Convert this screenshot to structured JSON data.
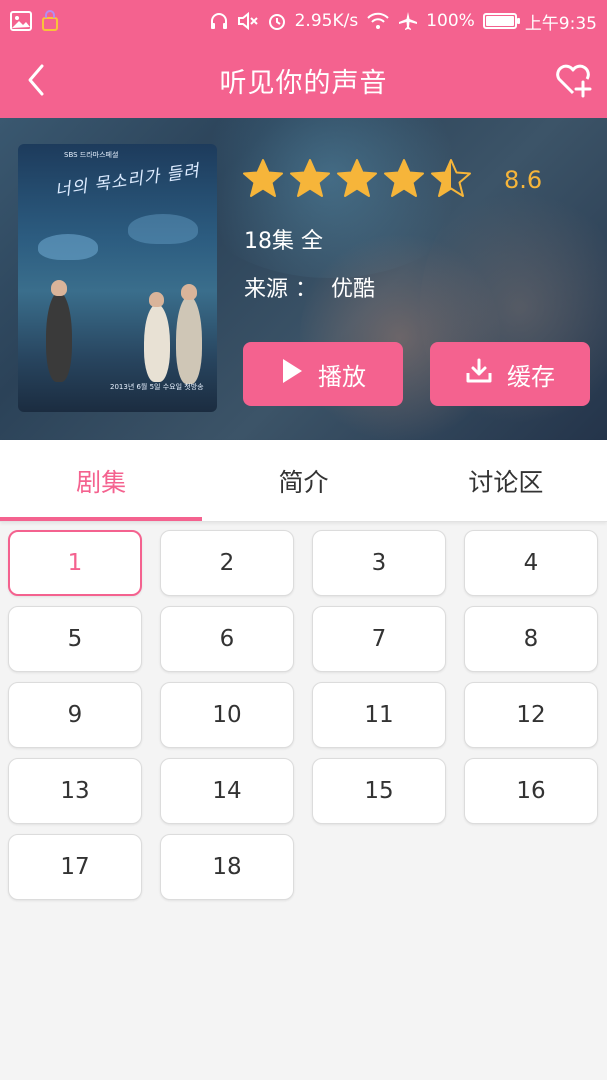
{
  "status_bar": {
    "speed": "2.95K/s",
    "battery_percent": "100%",
    "time": "上午9:35",
    "battery_level": 1.0
  },
  "nav": {
    "title": "听见你的声音"
  },
  "hero": {
    "rating_stars": 4.5,
    "max_stars": 5,
    "score": "8.6",
    "episodes_total": "18集 全",
    "source": "来源 ：  优酷",
    "poster": {
      "logo": "SBS 드라마스페셜",
      "title": "너의 목소리가 들려",
      "date": "2013년 6월 5일 수요일 첫방송"
    },
    "play_label": "播放",
    "cache_label": "缓存",
    "colors": {
      "accent": "#f4628f",
      "star": "#f6b53a"
    }
  },
  "tabs": [
    {
      "label": "剧集",
      "active": true
    },
    {
      "label": "简介",
      "active": false
    },
    {
      "label": "讨论区",
      "active": false
    }
  ],
  "episodes": [
    "1",
    "2",
    "3",
    "4",
    "5",
    "6",
    "7",
    "8",
    "9",
    "10",
    "11",
    "12",
    "13",
    "14",
    "15",
    "16",
    "17",
    "18"
  ],
  "selected_episode": "1"
}
